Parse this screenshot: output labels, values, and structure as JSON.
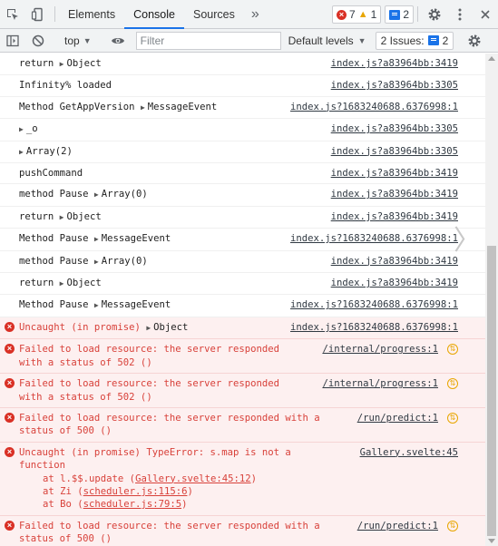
{
  "tabbar": {
    "tabs": [
      "Elements",
      "Console",
      "Sources"
    ],
    "active_tab": "Console",
    "error_count": "7",
    "warning_count": "1",
    "message_count": "2"
  },
  "filterbar": {
    "context": "top",
    "filter_placeholder": "Filter",
    "levels_label": "Default levels",
    "issues_label": "2 Issues:",
    "issues_count": "2"
  },
  "rows": [
    {
      "text": "return ",
      "obj": "Object",
      "src": "index.js?a83964bb:3419"
    },
    {
      "text": "Infinity% loaded",
      "src": "index.js?a83964bb:3305"
    },
    {
      "text": "Method GetAppVersion ",
      "obj": "MessageEvent",
      "src": "index.js?1683240688.6376998:1"
    },
    {
      "text": "",
      "obj": "_o",
      "src": "index.js?a83964bb:3305"
    },
    {
      "text": "",
      "obj": "Array(2)",
      "src": "index.js?a83964bb:3305"
    },
    {
      "text": "pushCommand",
      "src": "index.js?a83964bb:3419"
    },
    {
      "text": "method Pause ",
      "obj": "Array(0)",
      "src": "index.js?a83964bb:3419"
    },
    {
      "text": "return ",
      "obj": "Object",
      "src": "index.js?a83964bb:3419"
    },
    {
      "text": "Method Pause ",
      "obj": "MessageEvent",
      "src": "index.js?1683240688.6376998:1"
    },
    {
      "text": "method Pause ",
      "obj": "Array(0)",
      "src": "index.js?a83964bb:3419"
    },
    {
      "text": "return ",
      "obj": "Object",
      "src": "index.js?a83964bb:3419"
    },
    {
      "text": "Method Pause ",
      "obj": "MessageEvent",
      "src": "index.js?1683240688.6376998:1"
    }
  ],
  "errors": [
    {
      "text": "Uncaught (in promise) ",
      "obj": "Object",
      "src": "index.js?1683240688.6376998:1"
    },
    {
      "text": "Failed to load resource: the server responded\nwith a status of 502 ()",
      "src": "/internal/progress:1",
      "nav": true
    },
    {
      "text": "Failed to load resource: the server responded\nwith a status of 502 ()",
      "src": "/internal/progress:1",
      "nav": true
    },
    {
      "text": "Failed to load resource: the server responded with a\nstatus of 500 ()",
      "src": "/run/predict:1",
      "nav": true
    },
    {
      "text": "Uncaught (in promise) TypeError: s.map is not a\nfunction",
      "src": "Gallery.svelte:45",
      "stack": [
        {
          "prefix": "at l.$$.update (",
          "link": "Gallery.svelte:45:12",
          "suffix": ")"
        },
        {
          "prefix": "at Zi (",
          "link": "scheduler.js:115:6",
          "suffix": ")"
        },
        {
          "prefix": "at Bo (",
          "link": "scheduler.js:79:5",
          "suffix": ")"
        }
      ]
    },
    {
      "text": "Failed to load resource: the server responded with a\nstatus of 500 ()",
      "src": "/run/predict:1",
      "nav": true
    }
  ],
  "prompt": "›"
}
